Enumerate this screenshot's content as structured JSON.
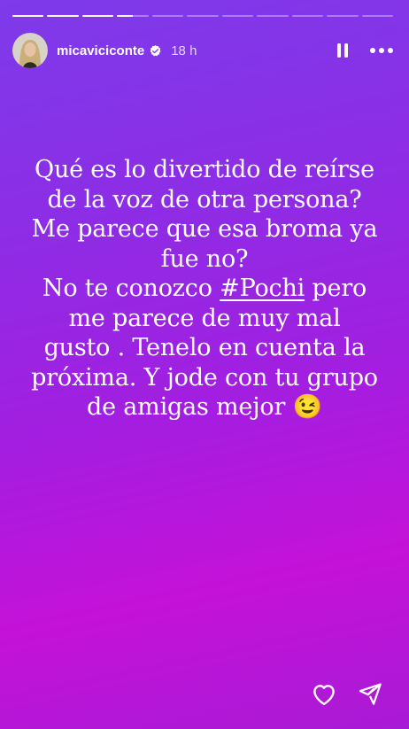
{
  "progress": {
    "segments": [
      1,
      1,
      1,
      0.5,
      0,
      0,
      0,
      0,
      0,
      0,
      0
    ]
  },
  "header": {
    "username": "micaviciconte",
    "timestamp": "18 h",
    "verified": true
  },
  "story": {
    "lines": [
      "Qué es lo divertido de reírse",
      "de la voz de otra persona?",
      "Me parece que esa broma ya",
      "fue no?",
      "No te conozco ",
      " pero",
      "me parece de muy mal",
      "gusto . Tenelo en cuenta la",
      "próxima. Y jode con tu grupo",
      "de amigas mejor "
    ],
    "hashtag": "#Pochi",
    "emoji": "😉"
  },
  "icons": {
    "verified": "verified-badge-icon",
    "pause": "pause-icon",
    "more": "more-options-icon",
    "like": "heart-icon",
    "share": "send-icon"
  }
}
